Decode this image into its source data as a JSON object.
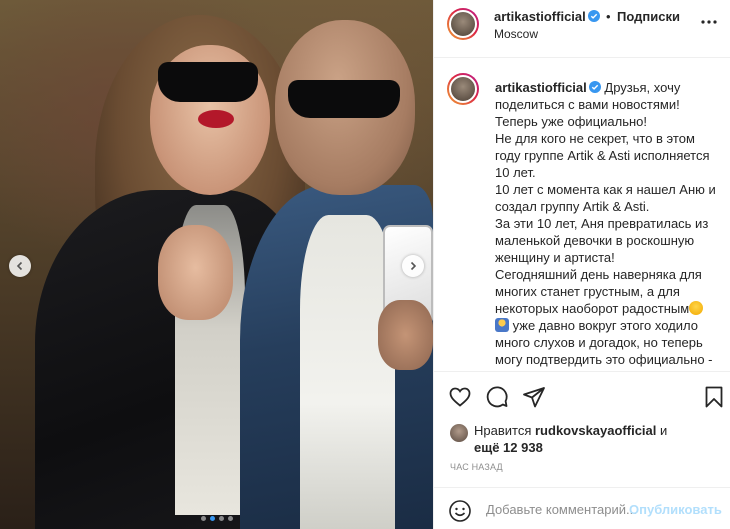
{
  "post": {
    "username": "artikastiofficial",
    "follow_label": "Подписки",
    "separator": "•",
    "location": "Moscow",
    "caption_lines": [
      "Друзья, хочу поделиться с вами новостями! Теперь уже официально!",
      "Не для кого не секрет, что в этом году группе Artik & Asti исполняется 10 лет.",
      "10 лет с момента как я нашел Аню и создал группу Artik & Asti.",
      "За эти 10 лет, Аня превратилась из маленькой девочки в роскошную женщину и артиста!",
      "Сегодняшний день наверняка для многих станет грустным, а для некоторых наоборот радостным",
      "уже давно вокруг этого ходило много слухов и догадок, но теперь могу подтвердить это официально - Аня покидает группу Artik & Asti."
    ],
    "likes_prefix": "Нравится",
    "liked_by": "rudkovskayaofficial",
    "likes_connector": "и",
    "likes_others": "ещё 12 938",
    "timestamp": "Час назад"
  },
  "comment": {
    "placeholder": "Добавьте комментарий...",
    "publish_label": "Опубликовать"
  },
  "carousel": {
    "slide_count": 4,
    "active_index": 1
  },
  "icons": [
    "more-icon",
    "heart-icon",
    "comment-icon",
    "share-icon",
    "bookmark-icon",
    "emoji-icon",
    "verified-badge-icon",
    "chevron-left-icon",
    "chevron-right-icon"
  ],
  "colors": {
    "link": "#3897f0",
    "verified": "#3897f0",
    "publish_disabled": "#b2dffc",
    "muted": "#8e8e8e"
  }
}
